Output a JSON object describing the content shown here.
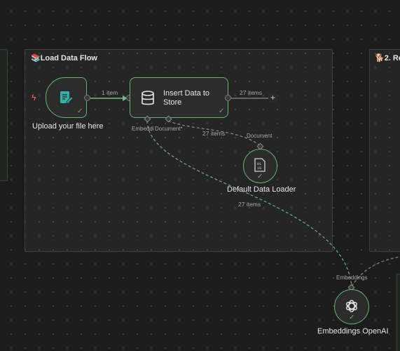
{
  "groups": {
    "load_flow_title": "📚Load Data Flow",
    "retriever_title": "🐕2. Re"
  },
  "nodes": {
    "upload": {
      "label": "Upload your file here",
      "icon": "document-edit-icon"
    },
    "insert": {
      "label_line1": "Insert Data to",
      "label_line2": "Store",
      "icon": "database-icon"
    },
    "loader": {
      "label": "Default Data Loader",
      "icon": "binary-file-icon"
    },
    "embeddings": {
      "label": "Embeddings OpenAI",
      "icon": "openai-icon"
    }
  },
  "edges": {
    "upload_to_insert": "1 item",
    "insert_output": "27 items",
    "loader_to_insert": "27 items",
    "embeddings_to_insert": "27 items"
  },
  "ports": {
    "insert_embedding": "Embeddi",
    "insert_document": "Document*",
    "loader_document": "Document",
    "embeddings_out": "Embeddings"
  },
  "symbols": {
    "check": "✓",
    "plus": "+",
    "bolt": "ϟ"
  },
  "colors": {
    "success": "#5fb772",
    "trigger": "#ff6d5a",
    "teal_icon": "#35b0a8"
  }
}
